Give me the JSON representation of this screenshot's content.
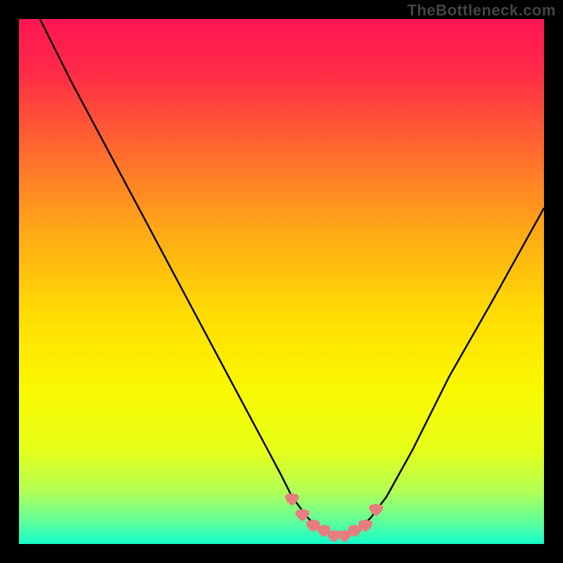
{
  "watermark": "TheBottleneck.com",
  "chart_data": {
    "type": "line",
    "title": "",
    "xlabel": "",
    "ylabel": "",
    "xlim": [
      0,
      100
    ],
    "ylim": [
      0,
      100
    ],
    "grid": false,
    "legend": false,
    "background_gradient": {
      "direction": "vertical",
      "stops": [
        {
          "pos": 0.0,
          "color": "#ff1553"
        },
        {
          "pos": 0.1,
          "color": "#ff2a47"
        },
        {
          "pos": 0.25,
          "color": "#ff6a2e"
        },
        {
          "pos": 0.4,
          "color": "#ffa717"
        },
        {
          "pos": 0.55,
          "color": "#ffd903"
        },
        {
          "pos": 0.7,
          "color": "#faf800"
        },
        {
          "pos": 0.82,
          "color": "#e6ff18"
        },
        {
          "pos": 0.9,
          "color": "#b2ff56"
        },
        {
          "pos": 0.96,
          "color": "#5cff9e"
        },
        {
          "pos": 1.0,
          "color": "#14fcca"
        }
      ]
    },
    "series": [
      {
        "name": "bottleneck-curve",
        "color": "#000000",
        "x": [
          4,
          10,
          18,
          26,
          34,
          42,
          50,
          52,
          55,
          57,
          59,
          61,
          63,
          65,
          67,
          70,
          75,
          82,
          90,
          100
        ],
        "y": [
          100,
          88,
          73,
          58,
          43,
          28,
          13,
          9,
          5,
          3,
          2,
          2,
          2,
          3,
          5,
          9,
          18,
          32,
          46,
          64
        ]
      },
      {
        "name": "valley-highlight",
        "color": "#e67e80",
        "style": "thick-dotted",
        "x": [
          52,
          54,
          56,
          58,
          60,
          62,
          64,
          66,
          68
        ],
        "y": [
          9,
          6,
          4,
          3,
          2,
          2,
          3,
          4,
          7
        ]
      }
    ]
  }
}
